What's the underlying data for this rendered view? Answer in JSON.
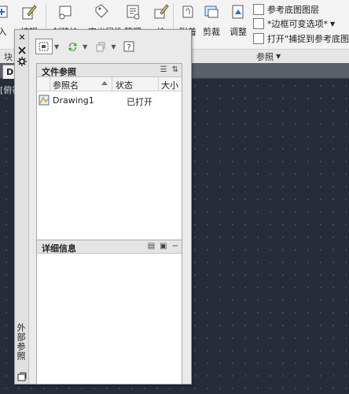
{
  "ribbon": {
    "buttons": [
      {
        "label": "入",
        "icon": "insert-icon"
      },
      {
        "label": "编辑",
        "icon": "edit-attributes-icon"
      },
      {
        "label": "创建块",
        "icon": "create-block-icon"
      },
      {
        "label": "定义属性",
        "icon": "define-attributes-icon"
      },
      {
        "label": "管理",
        "icon": "manage-icon"
      },
      {
        "label": "块",
        "icon": "block-icon"
      },
      {
        "label": "附着",
        "icon": "attach-icon"
      },
      {
        "label": "剪裁",
        "icon": "clip-icon"
      },
      {
        "label": "调整",
        "icon": "adjust-icon"
      }
    ],
    "small_items": [
      {
        "label": "参考底图图层"
      },
      {
        "label": "*边框可变选项*"
      },
      {
        "label": "打开\"捕捉到参考底图\"功"
      }
    ],
    "groups": {
      "block_label": "块",
      "reference_label": "参照",
      "reference_dropdown": "▼"
    }
  },
  "doc_tab": {
    "label": "D"
  },
  "viewport_label": "[俯视",
  "palette": {
    "close_icon": "✕",
    "vertical_title": "外部参照",
    "file_refs": {
      "title": "文件参照",
      "columns": [
        "参照名",
        "状态",
        "大小"
      ],
      "rows": [
        {
          "name": "Drawing1",
          "status": "已打开"
        }
      ]
    },
    "details": {
      "title": "详细信息"
    }
  },
  "colors": {
    "ribbon_bg": "#f3f3f3",
    "canvas_bg": "#262c38",
    "panel_bg": "#ffffff",
    "palette_bg": "#eaeaea",
    "refresh_green": "#2e9c2e"
  }
}
